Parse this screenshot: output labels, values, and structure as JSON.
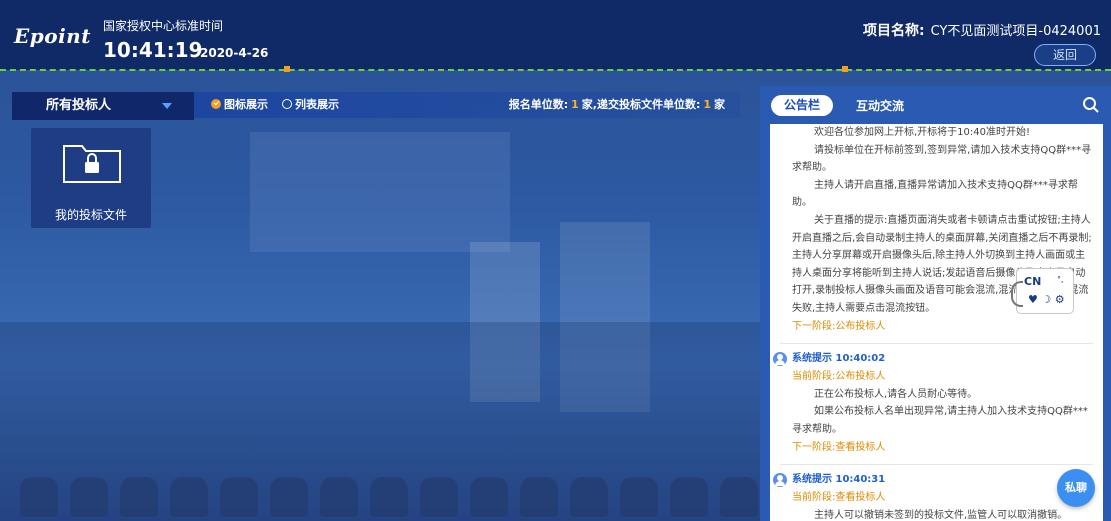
{
  "header": {
    "logo": "Epoint",
    "time_label": "国家授权中心标准时间",
    "clock": "10:41:19",
    "date": "2020-4-26",
    "project_key": "项目名称:",
    "project_name": "CY不见面测试项目-0424001",
    "back_label": "返回"
  },
  "toolbar": {
    "scope_label": "所有投标人",
    "view_icon_label": "图标展示",
    "view_list_label": "列表展示",
    "view_selected": "图标展示",
    "stats_prefix": "报名单位数:",
    "registered_count": "1",
    "stats_middle": "家,递交投标文件单位数:",
    "submitted_count": "1",
    "stats_suffix": "家"
  },
  "tiles": [
    {
      "label": "我的投标文件"
    }
  ],
  "panel": {
    "tab_active": "公告栏",
    "tab_other": "互动交流",
    "feed": {
      "intro": [
        "欢迎各位参加网上开标,开标将于10:40准时开始!",
        "请投标单位在开标前签到,签到异常,请加入技术支持QQ群***寻求帮助。",
        "主持人请开启直播,直播异常请加入技术支持QQ群***寻求帮助。",
        "关于直播的提示:直播页面消失或者卡顿请点击重试按钮;主持人开启直播之后,会自动录制主持人的桌面屏幕,关闭直播之后不再录制;主持人分享屏幕或开启摄像头后,除主持人外切换到主持人画面或主持人桌面分享将能听到主持人说话;发起语音后摄像头及麦克风自动打开,录制投标人摄像头画面及语音可能会混流,混流失败会提示混流失败,主持人需要点击混流按钮。"
      ],
      "intro_next": "下一阶段:公布投标人",
      "messages": [
        {
          "title": "系统提示 10:40:02",
          "current": "当前阶段:公布投标人",
          "lines": [
            "正在公布投标人,请各人员耐心等待。",
            "如果公布投标人名单出现异常,请主持人加入技术支持QQ群***寻求帮助。"
          ],
          "next": "下一阶段:查看投标人"
        },
        {
          "title": "系统提示 10:40:31",
          "current": "当前阶段:查看投标人",
          "lines": [
            "主持人可以撤销未签到的投标文件,监管人可以取消撤销。"
          ]
        }
      ]
    },
    "chat_label": "私聊",
    "widget_label": "CN"
  },
  "colors": {
    "header_bg": "#0f2a66",
    "accent_orange": "#ffb21f",
    "accent_blue": "#1f5fd0",
    "dash_green": "#6fcf3a"
  }
}
